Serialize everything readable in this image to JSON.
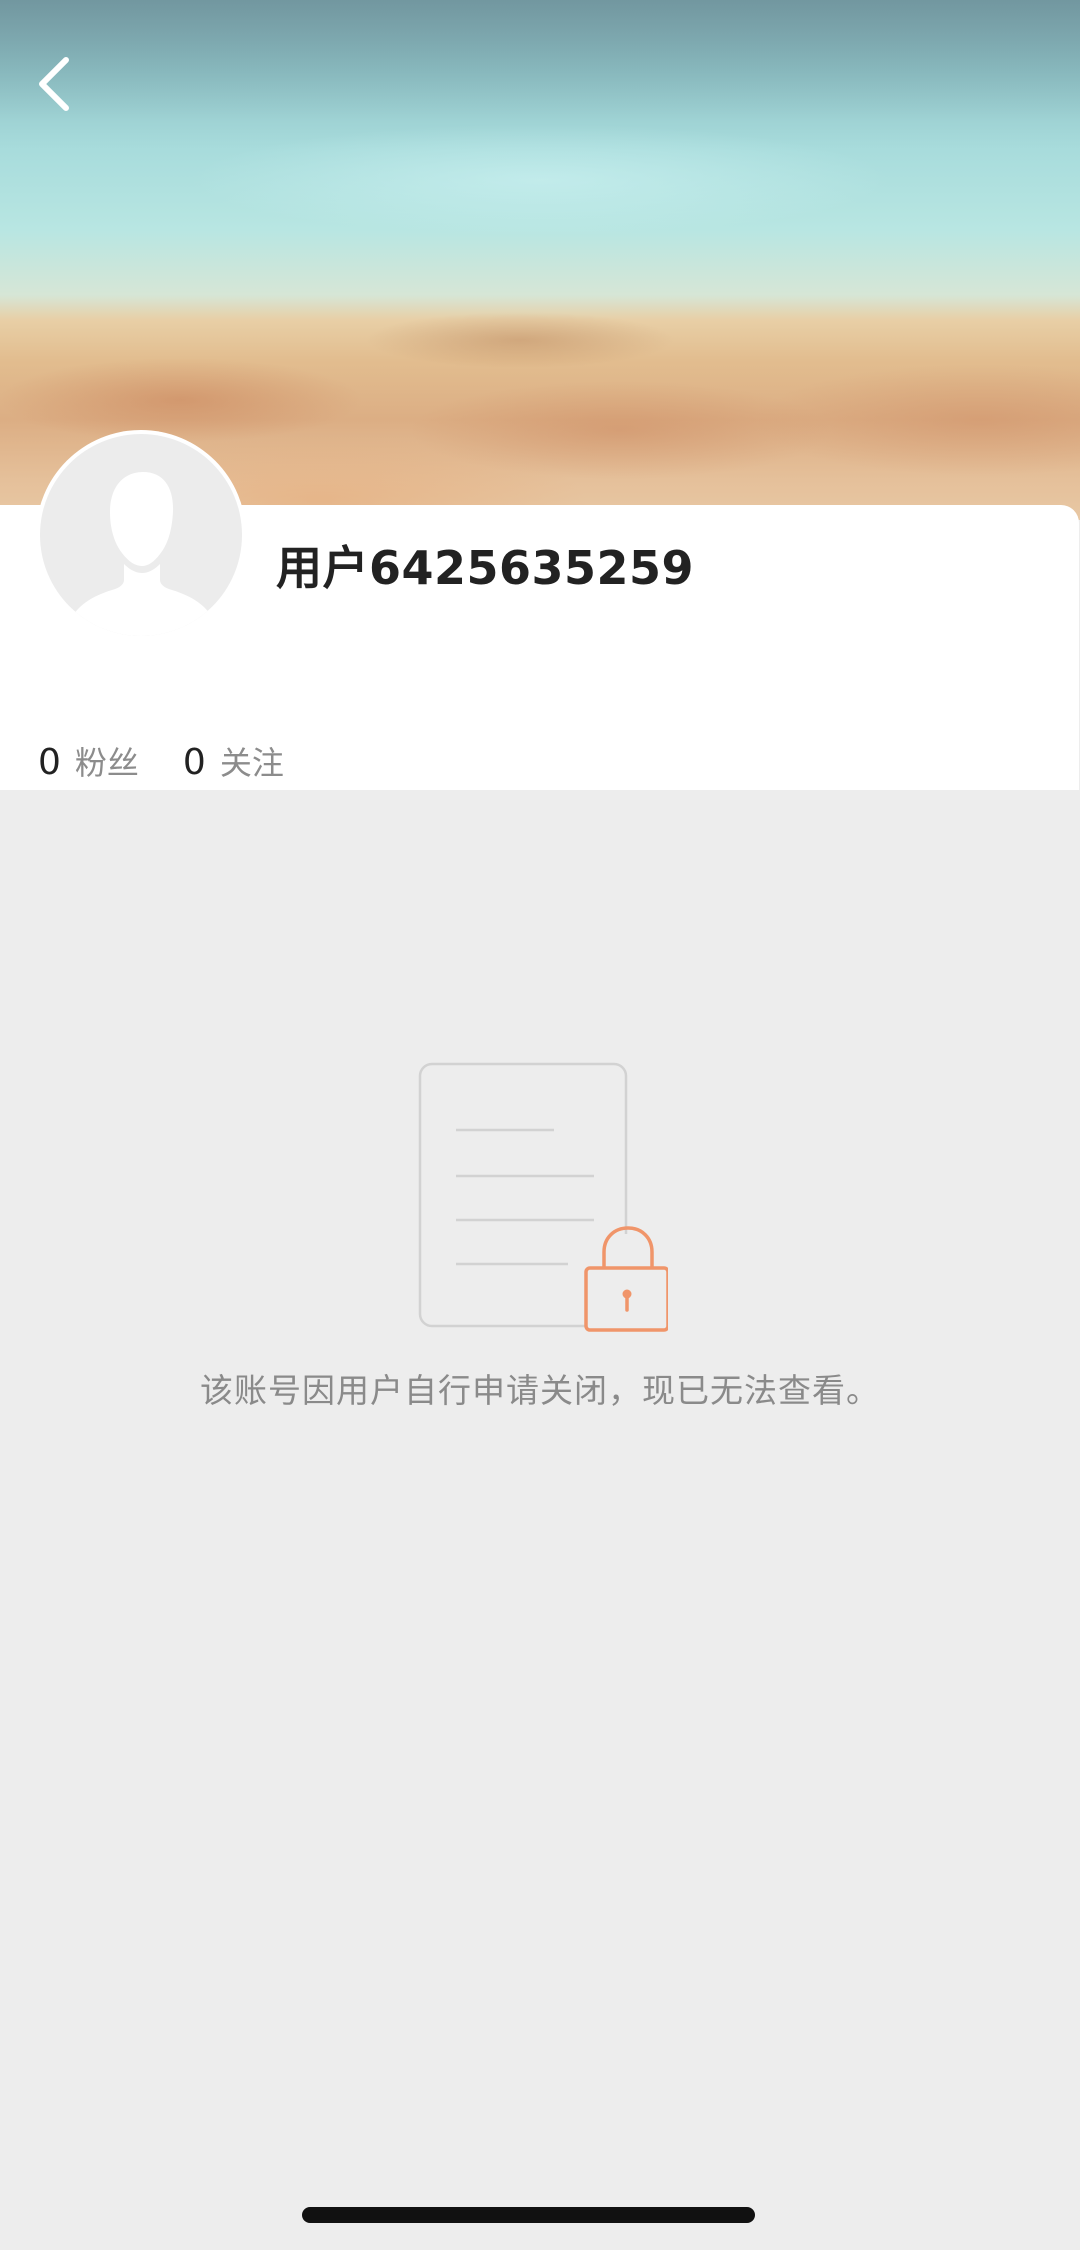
{
  "header": {
    "back_icon": "chevron-left-icon"
  },
  "cover": {
    "description_icon": "beach-cover-image"
  },
  "profile": {
    "avatar_icon": "default-avatar-icon",
    "username": "用户6425635259",
    "stats": [
      {
        "count": "0",
        "label": "粉丝"
      },
      {
        "count": "0",
        "label": "关注"
      }
    ]
  },
  "notice": {
    "icon": "locked-document-icon",
    "message": "该账号因用户自行申请关闭，现已无法查看。",
    "accent_color": "#f0956a"
  },
  "colors": {
    "page_background": "#ededed",
    "card_background": "#ffffff",
    "username_color": "#222222",
    "muted_text": "#8a8a8a"
  }
}
